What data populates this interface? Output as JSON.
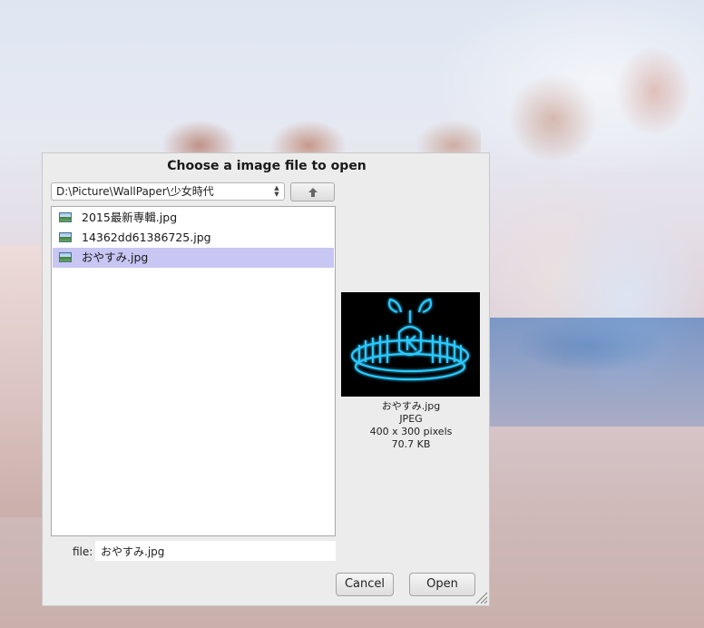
{
  "dialog": {
    "title": "Choose a image file to open",
    "path": "D:\\Picture\\WallPaper\\少女時代",
    "up_icon": "up-arrow-icon",
    "files": [
      {
        "name": "2015最新専輯.jpg",
        "selected": false
      },
      {
        "name": "14362dd61386725.jpg",
        "selected": false
      },
      {
        "name": "おやすみ.jpg",
        "selected": true
      }
    ],
    "preview": {
      "name": "おやすみ.jpg",
      "format": "JPEG",
      "dimensions": "400 x 300 pixels",
      "size": "70.7 KB"
    },
    "file_label": "file:",
    "file_value": "おやすみ.jpg",
    "cancel_label": "Cancel",
    "open_label": "Open"
  },
  "colors": {
    "selection": "#c8c6f3",
    "dialog_bg": "#ececec",
    "neon": "#29c8ff"
  }
}
